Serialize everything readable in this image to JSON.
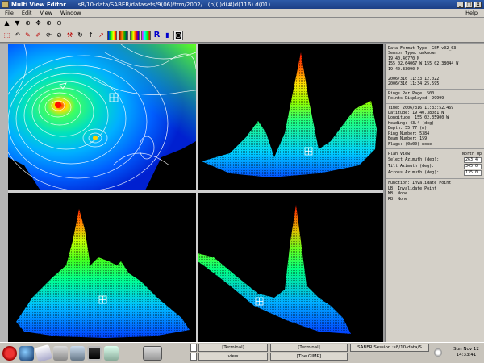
{
  "window": {
    "title": "Multi View Editor",
    "path": "...:s8/10-data/SABER/datasets/9(06)/trm/2002/...(b)(i)d(#)d(116).d(01)",
    "controls": [
      "_",
      "□",
      "x"
    ]
  },
  "menu": {
    "items": [
      "File",
      "Edit",
      "View",
      "Window"
    ],
    "help": "Help"
  },
  "toolbar": {
    "row1": [
      "up-arrow-icon",
      "down-arrow-icon",
      "zoom-icon",
      "pan-icon",
      "zoom-in-icon",
      "zoom-out-icon"
    ],
    "row2": [
      "select-icon",
      "undo-icon",
      "draw-icon",
      "edit-icon",
      "rotate-icon",
      "measure-icon",
      "tool-icon",
      "arc-icon",
      "north-arrow-icon",
      "pointer-icon",
      "color-map-1-icon",
      "color-map-2-icon",
      "color-map-3-icon",
      "color-map-4-icon",
      "letter-r-icon",
      "bar-chart-icon",
      "camera-icon"
    ],
    "r_label": "R"
  },
  "info_panel": {
    "header": [
      "Data Format Type: GSF-v02_03",
      "Sensor Type: unknown",
      "    19 40.40770 N",
      "155 02.64067 W        155 02.38044 W",
      "    19 40.33090 N",
      "  2006/316 11:33:12.022",
      "  2006/316 11:34:25.595"
    ],
    "ping_info": [
      "Pings Per Page: 500",
      "Points Displayed: 99999"
    ],
    "point_info": [
      "Time: 2006/316 11:33:52.469",
      "Latitude:   19 40.38081 N",
      "Longitude: 155 02.35900 W",
      "Heading: 43.4 (deg)",
      "Depth: 55.77 (m)",
      "Ping Number: 5384",
      "Beam Number: 159",
      "Flags: (0x00)-none"
    ],
    "plan_view": {
      "title": "Plan View:",
      "side": "North Up",
      "fields": [
        {
          "label": "Select Azimuth (deg):",
          "value": "263.4"
        },
        {
          "label": "Tilt Azimuth (deg):",
          "value": "345.0"
        },
        {
          "label": "Across Azimuth (deg):",
          "value": "135.0"
        }
      ]
    },
    "function": [
      "Function: Invalidate Point",
      "    LB: Invalidate Point",
      "    MB: None",
      "    RB: None"
    ]
  },
  "taskbar": {
    "tasks": [
      {
        "label": "[Terminal]"
      },
      {
        "label": "[Terminal]"
      },
      {
        "label": "SABER Session :s8/10-data/S"
      },
      {
        "label": "view"
      },
      {
        "label": "[The GIMP]"
      }
    ],
    "clock_date": "Sun Nov 12",
    "clock_time": "14:33:41"
  },
  "colors": {
    "title_bar": "#1c3f86",
    "panel_bg": "#d4d0c8",
    "plot_bg": "#000000"
  }
}
